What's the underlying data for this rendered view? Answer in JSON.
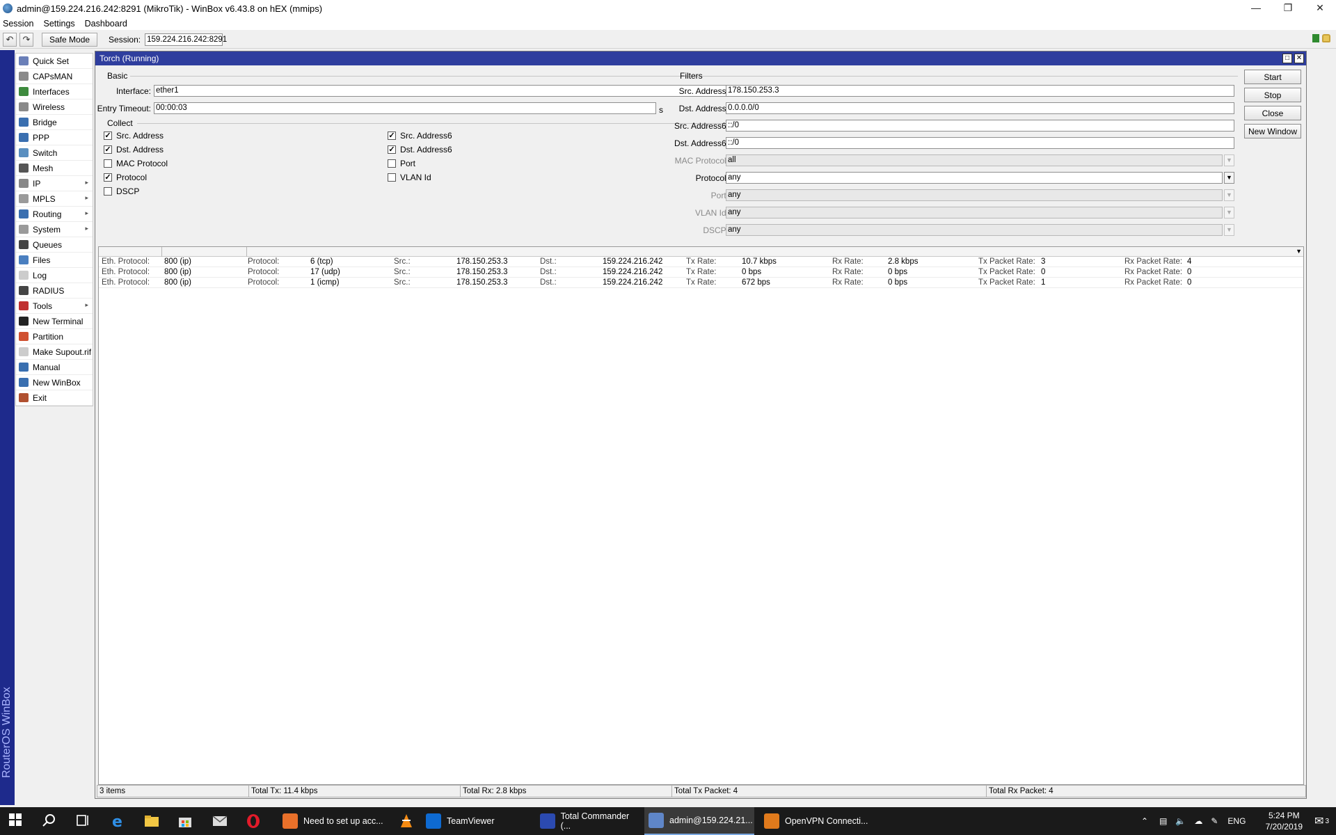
{
  "window": {
    "title": "admin@159.224.216.242:8291 (MikroTik) - WinBox v6.43.8 on hEX (mmips)"
  },
  "menu": [
    "Session",
    "Settings",
    "Dashboard"
  ],
  "toolbar": {
    "safe_mode": "Safe Mode",
    "session_label": "Session:",
    "session_value": "159.224.216.242:8291"
  },
  "brand_vertical": "RouterOS WinBox",
  "sidebar": {
    "items": [
      {
        "label": "Quick Set",
        "icon": "quickset-icon",
        "color": "#6a7fb8",
        "sub": false
      },
      {
        "label": "CAPsMAN",
        "icon": "capsman-icon",
        "color": "#8a8a8a",
        "sub": false
      },
      {
        "label": "Interfaces",
        "icon": "interfaces-icon",
        "color": "#3d8a3d",
        "sub": false
      },
      {
        "label": "Wireless",
        "icon": "wireless-icon",
        "color": "#8a8a8a",
        "sub": false
      },
      {
        "label": "Bridge",
        "icon": "bridge-icon",
        "color": "#3a6fb0",
        "sub": false
      },
      {
        "label": "PPP",
        "icon": "ppp-icon",
        "color": "#3a6fb0",
        "sub": false
      },
      {
        "label": "Switch",
        "icon": "switch-icon",
        "color": "#5a8fc0",
        "sub": false
      },
      {
        "label": "Mesh",
        "icon": "mesh-icon",
        "color": "#555555",
        "sub": false
      },
      {
        "label": "IP",
        "icon": "ip-icon",
        "color": "#888888",
        "sub": true
      },
      {
        "label": "MPLS",
        "icon": "mpls-icon",
        "color": "#9a9a9a",
        "sub": true
      },
      {
        "label": "Routing",
        "icon": "routing-icon",
        "color": "#3a6fb0",
        "sub": true
      },
      {
        "label": "System",
        "icon": "system-icon",
        "color": "#9a9a9a",
        "sub": true
      },
      {
        "label": "Queues",
        "icon": "queues-icon",
        "color": "#444444",
        "sub": false
      },
      {
        "label": "Files",
        "icon": "files-icon",
        "color": "#4a7fc0",
        "sub": false
      },
      {
        "label": "Log",
        "icon": "log-icon",
        "color": "#cccccc",
        "sub": false
      },
      {
        "label": "RADIUS",
        "icon": "radius-icon",
        "color": "#444444",
        "sub": false
      },
      {
        "label": "Tools",
        "icon": "tools-icon",
        "color": "#c03030",
        "sub": true
      },
      {
        "label": "New Terminal",
        "icon": "terminal-icon",
        "color": "#222222",
        "sub": false
      },
      {
        "label": "Partition",
        "icon": "partition-icon",
        "color": "#d05030",
        "sub": false
      },
      {
        "label": "Make Supout.rif",
        "icon": "supout-icon",
        "color": "#cccccc",
        "sub": false
      },
      {
        "label": "Manual",
        "icon": "manual-icon",
        "color": "#3a6fb0",
        "sub": false
      },
      {
        "label": "New WinBox",
        "icon": "winbox-icon",
        "color": "#3a6fb0",
        "sub": false
      },
      {
        "label": "Exit",
        "icon": "exit-icon",
        "color": "#b05030",
        "sub": false
      }
    ]
  },
  "torch": {
    "title": "Torch (Running)",
    "basic_label": "Basic",
    "interface_label": "Interface:",
    "interface_value": "ether1",
    "timeout_label": "Entry Timeout:",
    "timeout_value": "00:00:03",
    "timeout_unit": "s",
    "collect_label": "Collect",
    "collect": [
      {
        "label": "Src. Address",
        "checked": true
      },
      {
        "label": "Dst. Address",
        "checked": true
      },
      {
        "label": "MAC Protocol",
        "checked": false
      },
      {
        "label": "Protocol",
        "checked": true
      },
      {
        "label": "DSCP",
        "checked": false
      },
      {
        "label": "Src. Address6",
        "checked": true
      },
      {
        "label": "Dst. Address6",
        "checked": true
      },
      {
        "label": "Port",
        "checked": false
      },
      {
        "label": "VLAN Id",
        "checked": false
      }
    ],
    "filters_label": "Filters",
    "filters": [
      {
        "label": "Src. Address:",
        "value": "178.150.253.3",
        "disabled": false,
        "dropdown": false
      },
      {
        "label": "Dst. Address:",
        "value": "0.0.0.0/0",
        "disabled": false,
        "dropdown": false
      },
      {
        "label": "Src. Address6:",
        "value": "::/0",
        "disabled": false,
        "dropdown": false
      },
      {
        "label": "Dst. Address6:",
        "value": "::/0",
        "disabled": false,
        "dropdown": false
      },
      {
        "label": "MAC Protocol:",
        "value": "all",
        "disabled": true,
        "dropdown": true
      },
      {
        "label": "Protocol:",
        "value": "any",
        "disabled": false,
        "dropdown": true
      },
      {
        "label": "Port:",
        "value": "any",
        "disabled": true,
        "dropdown": true
      },
      {
        "label": "VLAN Id:",
        "value": "any",
        "disabled": true,
        "dropdown": true
      },
      {
        "label": "DSCP:",
        "value": "any",
        "disabled": true,
        "dropdown": true
      }
    ],
    "buttons": {
      "start": "Start",
      "stop": "Stop",
      "close": "Close",
      "new_window": "New Window"
    },
    "row_keys": {
      "eth": "Eth. Protocol:",
      "proto": "Protocol:",
      "src": "Src.:",
      "dst": "Dst.:",
      "tx": "Tx Rate:",
      "rx": "Rx Rate:",
      "txp": "Tx Packet Rate:",
      "rxp": "Rx Packet Rate:"
    },
    "rows": [
      {
        "eth": "800 (ip)",
        "proto": "6 (tcp)",
        "src": "178.150.253.3",
        "dst": "159.224.216.242",
        "tx": "10.7 kbps",
        "rx": "2.8 kbps",
        "txp": "3",
        "rxp": "4"
      },
      {
        "eth": "800 (ip)",
        "proto": "17 (udp)",
        "src": "178.150.253.3",
        "dst": "159.224.216.242",
        "tx": "0 bps",
        "rx": "0 bps",
        "txp": "0",
        "rxp": "0"
      },
      {
        "eth": "800 (ip)",
        "proto": "1 (icmp)",
        "src": "178.150.253.3",
        "dst": "159.224.216.242",
        "tx": "672 bps",
        "rx": "0 bps",
        "txp": "1",
        "rxp": "0"
      }
    ],
    "status": {
      "items": "3 items",
      "total_tx": "Total Tx: 11.4 kbps",
      "total_rx": "Total Rx: 2.8 kbps",
      "total_tx_packet": "Total Tx Packet: 4",
      "total_rx_packet": "Total Rx Packet: 4"
    }
  },
  "taskbar": {
    "apps": [
      {
        "label": "Need to set up acc...",
        "icon": "firefox-icon",
        "color": "#e8702a"
      },
      {
        "label": "TeamViewer",
        "icon": "teamviewer-icon",
        "color": "#0e6ad1"
      },
      {
        "label": "Total Commander (...",
        "icon": "totalcmd-icon",
        "color": "#2b4ab0"
      },
      {
        "label": "admin@159.224.21...",
        "icon": "winbox-app-icon",
        "color": "#5f86c8"
      },
      {
        "label": "OpenVPN Connecti...",
        "icon": "openvpn-icon",
        "color": "#e07a1c"
      }
    ],
    "lang": "ENG",
    "time": "5:24 PM",
    "date": "7/20/2019",
    "notification_count": "3"
  }
}
